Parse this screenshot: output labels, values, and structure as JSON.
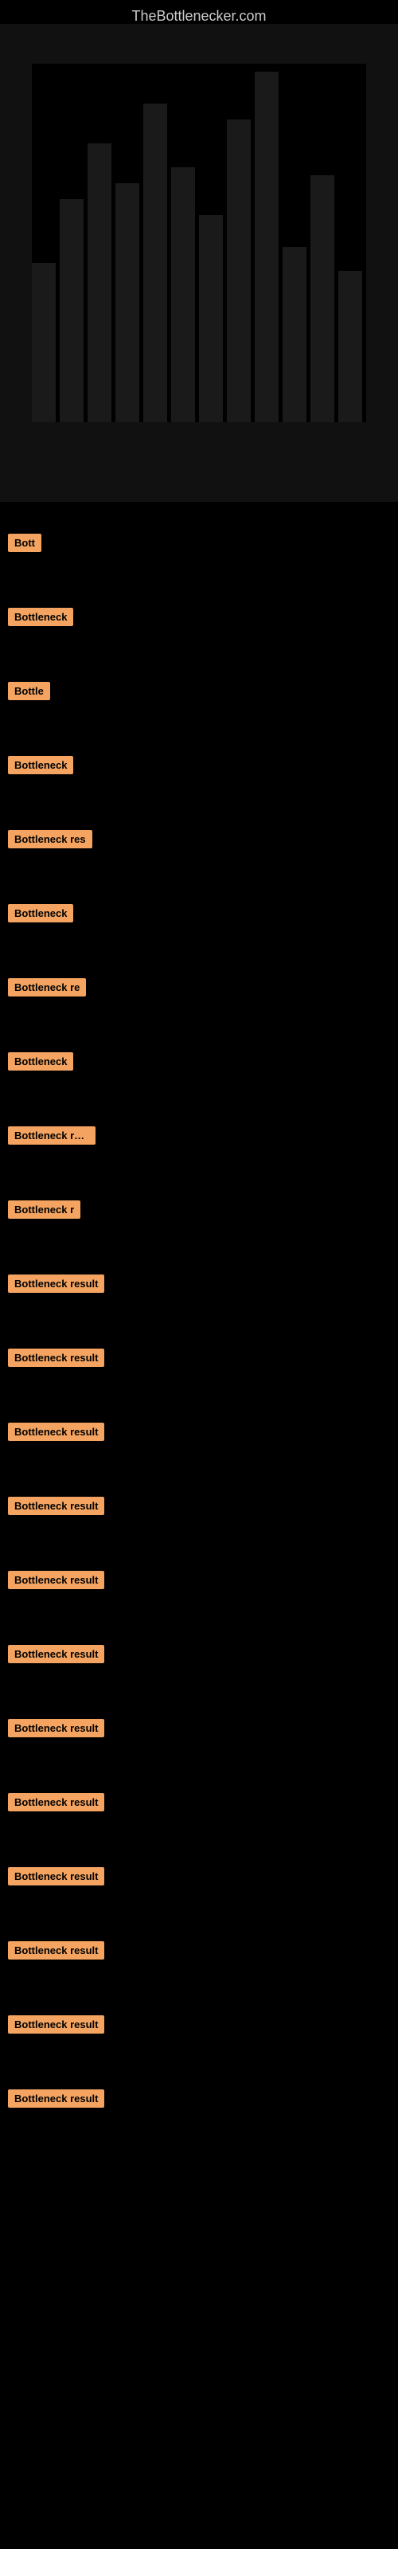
{
  "site": {
    "title": "TheBottlenecker.com"
  },
  "colors": {
    "background": "#000000",
    "badge": "#f4a460",
    "text": "#cccccc"
  },
  "bottleneck_items": [
    {
      "id": 1,
      "label": "Bottleneck result",
      "display": "Bott"
    },
    {
      "id": 2,
      "label": "Bottleneck result",
      "display": "Bottleneck"
    },
    {
      "id": 3,
      "label": "Bottleneck result",
      "display": "Bottle"
    },
    {
      "id": 4,
      "label": "Bottleneck result",
      "display": "Bottleneck"
    },
    {
      "id": 5,
      "label": "Bottleneck result",
      "display": "Bottleneck res"
    },
    {
      "id": 6,
      "label": "Bottleneck result",
      "display": "Bottleneck"
    },
    {
      "id": 7,
      "label": "Bottleneck result",
      "display": "Bottleneck re"
    },
    {
      "id": 8,
      "label": "Bottleneck result",
      "display": "Bottleneck"
    },
    {
      "id": 9,
      "label": "Bottleneck result",
      "display": "Bottleneck resu"
    },
    {
      "id": 10,
      "label": "Bottleneck result",
      "display": "Bottleneck r"
    },
    {
      "id": 11,
      "label": "Bottleneck result",
      "display": "Bottleneck result"
    },
    {
      "id": 12,
      "label": "Bottleneck result",
      "display": "Bottleneck result"
    },
    {
      "id": 13,
      "label": "Bottleneck result",
      "display": "Bottleneck result"
    },
    {
      "id": 14,
      "label": "Bottleneck result",
      "display": "Bottleneck result"
    },
    {
      "id": 15,
      "label": "Bottleneck result",
      "display": "Bottleneck result"
    },
    {
      "id": 16,
      "label": "Bottleneck result",
      "display": "Bottleneck result"
    },
    {
      "id": 17,
      "label": "Bottleneck result",
      "display": "Bottleneck result"
    },
    {
      "id": 18,
      "label": "Bottleneck result",
      "display": "Bottleneck result"
    },
    {
      "id": 19,
      "label": "Bottleneck result",
      "display": "Bottleneck result"
    },
    {
      "id": 20,
      "label": "Bottleneck result",
      "display": "Bottleneck result"
    },
    {
      "id": 21,
      "label": "Bottleneck result",
      "display": "Bottleneck result"
    },
    {
      "id": 22,
      "label": "Bottleneck result",
      "display": "Bottleneck result"
    }
  ]
}
